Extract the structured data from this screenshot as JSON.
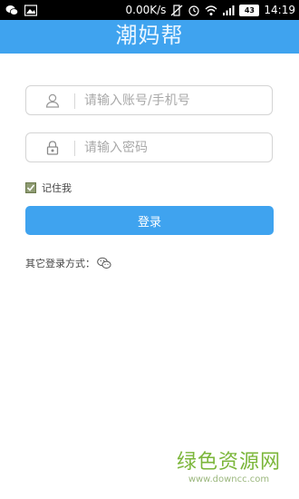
{
  "status_bar": {
    "speed": "0.00K/s",
    "battery": "43",
    "time": "14:19"
  },
  "header": {
    "title": "潮妈帮"
  },
  "login_form": {
    "account_placeholder": "请输入账号/手机号",
    "password_placeholder": "请输入密码",
    "remember_label": "记住我",
    "remember_checked": true,
    "login_button": "登录",
    "other_login_label": "其它登录方式："
  },
  "watermark": {
    "main": "绿色资源网",
    "sub": "www.downcc.com"
  },
  "colors": {
    "accent": "#3fa3ef",
    "checkbox": "#8e9b72",
    "watermark": "#7bb63a"
  },
  "icons": {
    "account": "user-icon",
    "password": "lock-icon",
    "other_login": "wechat-icon"
  }
}
